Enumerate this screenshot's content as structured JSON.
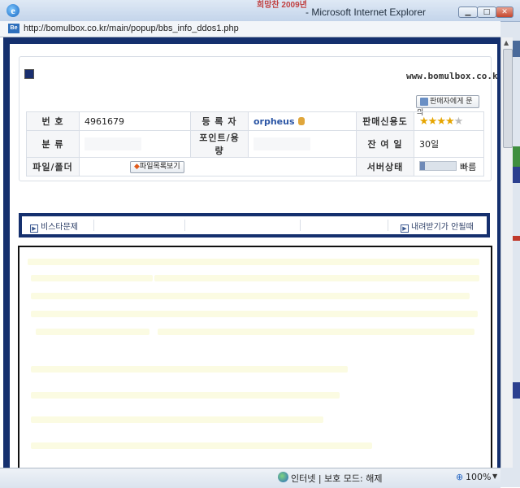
{
  "window": {
    "title": "- Microsoft Internet Explorer",
    "background_text": "희망찬 2009년",
    "buttons": {
      "minimize": "▁",
      "maximize": "□",
      "close": "✕"
    }
  },
  "address_bar": {
    "url": "http://bomulbox.co.kr/main/popup/bbs_info_ddos1.php"
  },
  "header": {
    "site": "www.bomulbox.co.kr",
    "ask_seller_label": "판매자에게 문의"
  },
  "info": {
    "number_label": "번    호",
    "number_value": "4961679",
    "category_label": "분    류",
    "files_label": "파일/폴더",
    "files_button": "파일목록보기",
    "files_button_icon": "diamond-icon",
    "uploader_label": "등 록 자",
    "uploader_value": "orpheus",
    "points_label": "포인트/용량",
    "seller_rating_label": "판매신용도",
    "seller_rating": 4,
    "seller_rating_max": 5,
    "remaining_label": "잔 여 일",
    "remaining_value": "30일",
    "server_label": "서버상태",
    "server_value": "빠름"
  },
  "tabs": {
    "left": "비스타문제",
    "right": "내려받기가 안될때",
    "arrow_icon": "arrow-right-box-icon"
  },
  "status_bar": {
    "zone": "인터넷 | 보호 모드: 해제",
    "zoom": "100%"
  },
  "colors": {
    "frame": "#15306e",
    "author": "#2c56a5",
    "stars": "#e6a500"
  }
}
